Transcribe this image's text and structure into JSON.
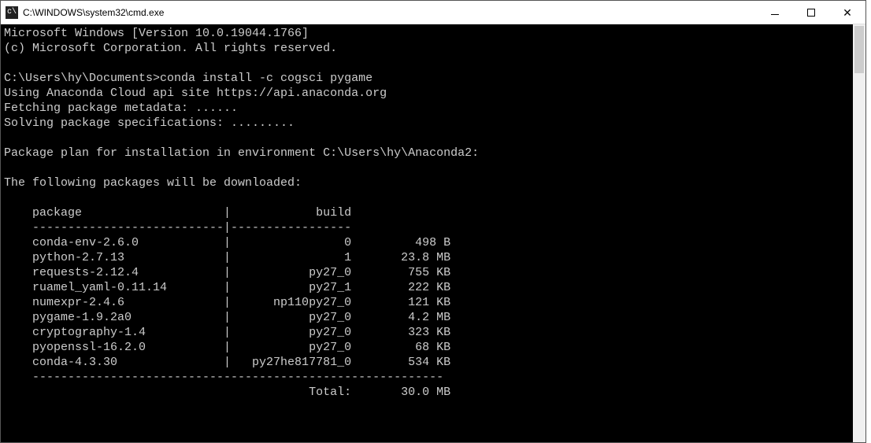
{
  "titlebar": {
    "title": "C:\\WINDOWS\\system32\\cmd.exe"
  },
  "terminal": {
    "banner_line1": "Microsoft Windows [Version 10.0.19044.1766]",
    "banner_line2": "(c) Microsoft Corporation. All rights reserved.",
    "prompt": "C:\\Users\\hy\\Documents>",
    "command": "conda install -c cogsci pygame",
    "line_api": "Using Anaconda Cloud api site https://api.anaconda.org",
    "line_fetch": "Fetching package metadata: ......",
    "line_solve": "Solving package specifications: .........",
    "line_plan": "Package plan for installation in environment C:\\Users\\hy\\Anaconda2:",
    "line_following": "The following packages will be downloaded:",
    "table_header_package": "package",
    "table_header_build": "build",
    "packages": [
      {
        "name": "conda-env-2.6.0",
        "build": "0",
        "size": "498 B"
      },
      {
        "name": "python-2.7.13",
        "build": "1",
        "size": "23.8 MB"
      },
      {
        "name": "requests-2.12.4",
        "build": "py27_0",
        "size": "755 KB"
      },
      {
        "name": "ruamel_yaml-0.11.14",
        "build": "py27_1",
        "size": "222 KB"
      },
      {
        "name": "numexpr-2.4.6",
        "build": "np110py27_0",
        "size": "121 KB"
      },
      {
        "name": "pygame-1.9.2a0",
        "build": "py27_0",
        "size": "4.2 MB"
      },
      {
        "name": "cryptography-1.4",
        "build": "py27_0",
        "size": "323 KB"
      },
      {
        "name": "pyopenssl-16.2.0",
        "build": "py27_0",
        "size": "68 KB"
      },
      {
        "name": "conda-4.3.30",
        "build": "py27he817781_0",
        "size": "534 KB"
      }
    ],
    "total_label": "Total:",
    "total_size": "30.0 MB"
  }
}
